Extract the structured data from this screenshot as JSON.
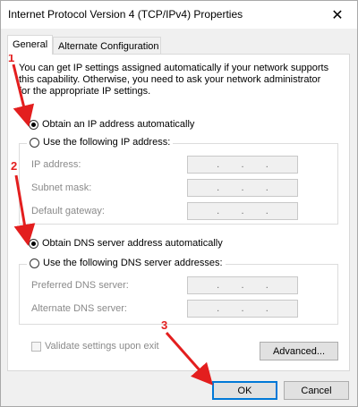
{
  "window": {
    "title": "Internet Protocol Version 4 (TCP/IPv4) Properties",
    "close_glyph": "✕"
  },
  "tabs": [
    {
      "label": "General",
      "active": true
    },
    {
      "label": "Alternate Configuration",
      "active": false
    }
  ],
  "description": "You can get IP settings assigned automatically if your network supports this capability. Otherwise, you need to ask your network administrator for the appropriate IP settings.",
  "ip_section": {
    "auto_label": "Obtain an IP address automatically",
    "auto_selected": true,
    "manual_label": "Use the following IP address:",
    "manual_selected": false,
    "fields": [
      {
        "label": "IP address:",
        "value": ".       .       ."
      },
      {
        "label": "Subnet mask:",
        "value": ".       .       ."
      },
      {
        "label": "Default gateway:",
        "value": ".       .       ."
      }
    ]
  },
  "dns_section": {
    "auto_label": "Obtain DNS server address automatically",
    "auto_selected": true,
    "manual_label": "Use the following DNS server addresses:",
    "manual_selected": false,
    "fields": [
      {
        "label": "Preferred DNS server:",
        "value": ".       .       ."
      },
      {
        "label": "Alternate DNS server:",
        "value": ".       .       ."
      }
    ]
  },
  "validate_label": "Validate settings upon exit",
  "buttons": {
    "advanced": "Advanced...",
    "ok": "OK",
    "cancel": "Cancel"
  },
  "annotations": [
    "1",
    "2",
    "3"
  ],
  "colors": {
    "annotation": "#e31e1e",
    "focus": "#0078d7"
  }
}
